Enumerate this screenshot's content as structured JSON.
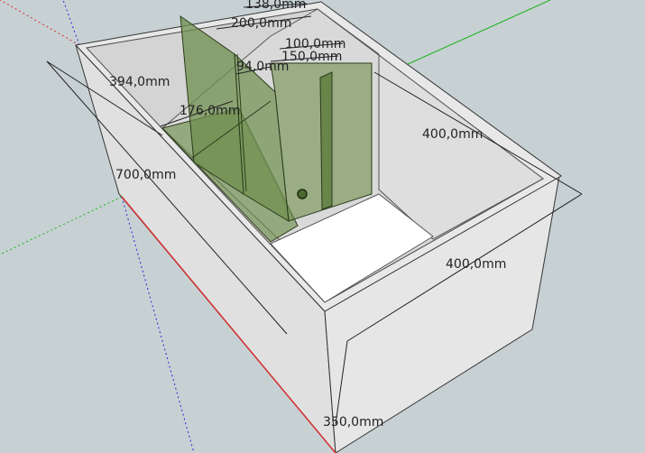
{
  "app": {
    "view": "3D model viewport",
    "colors": {
      "background": "#c7d1d4",
      "box_face": "#e3e3e3",
      "box_face_shadow": "#dcdcdc",
      "floor": "#ffffff",
      "glass": "#6f8f4d",
      "axis_red": "#d43030",
      "axis_green": "#19b219",
      "axis_blue": "#2a2ad8"
    }
  },
  "dimensions": {
    "d138": "138,0mm",
    "d200": "200,0mm",
    "d100": "100,0mm",
    "d150": "150,0mm",
    "d94": "94,0mm",
    "d394": "394,0mm",
    "d176": "176,0mm",
    "d400_top": "400,0mm",
    "d700": "700,0mm",
    "d400_side": "400,0mm",
    "d350": "350,0mm"
  }
}
